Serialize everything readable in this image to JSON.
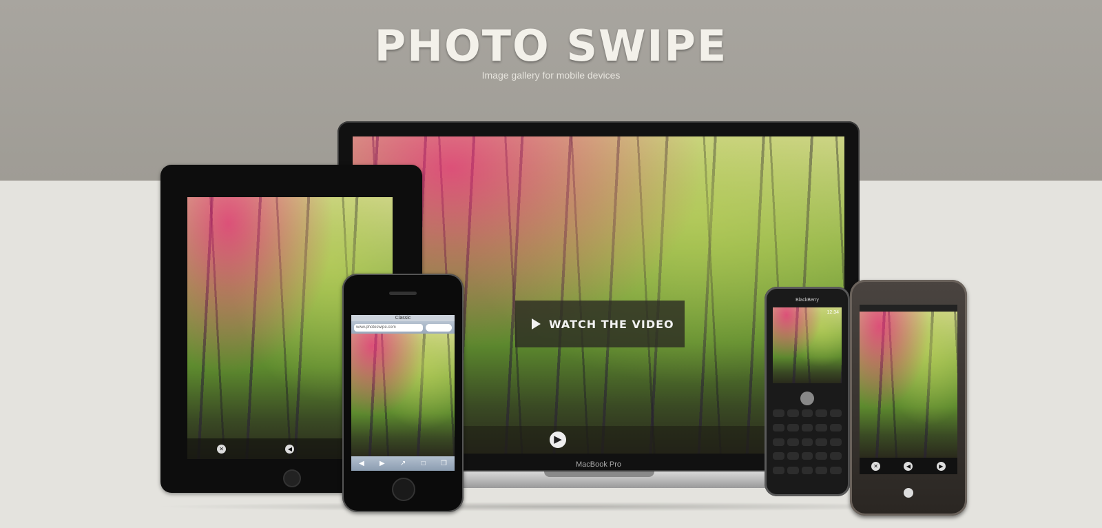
{
  "header": {
    "title": "PHOTO SWIPE",
    "subtitle": "Image gallery for mobile devices"
  },
  "laptop": {
    "brand": "MacBook Pro",
    "video_button": "WATCH THE VIDEO",
    "nav_prev_icon": "arrow-left-icon",
    "nav_next_icon": "play-icon"
  },
  "iphone": {
    "status": "Classic",
    "url": "www.photoswipe.com"
  },
  "blackberry": {
    "brand": "BlackBerry",
    "time": "12:34"
  },
  "colors": {
    "header_band": "#a39f99",
    "background": "#e4e3de",
    "title": "#f3f1ea"
  }
}
